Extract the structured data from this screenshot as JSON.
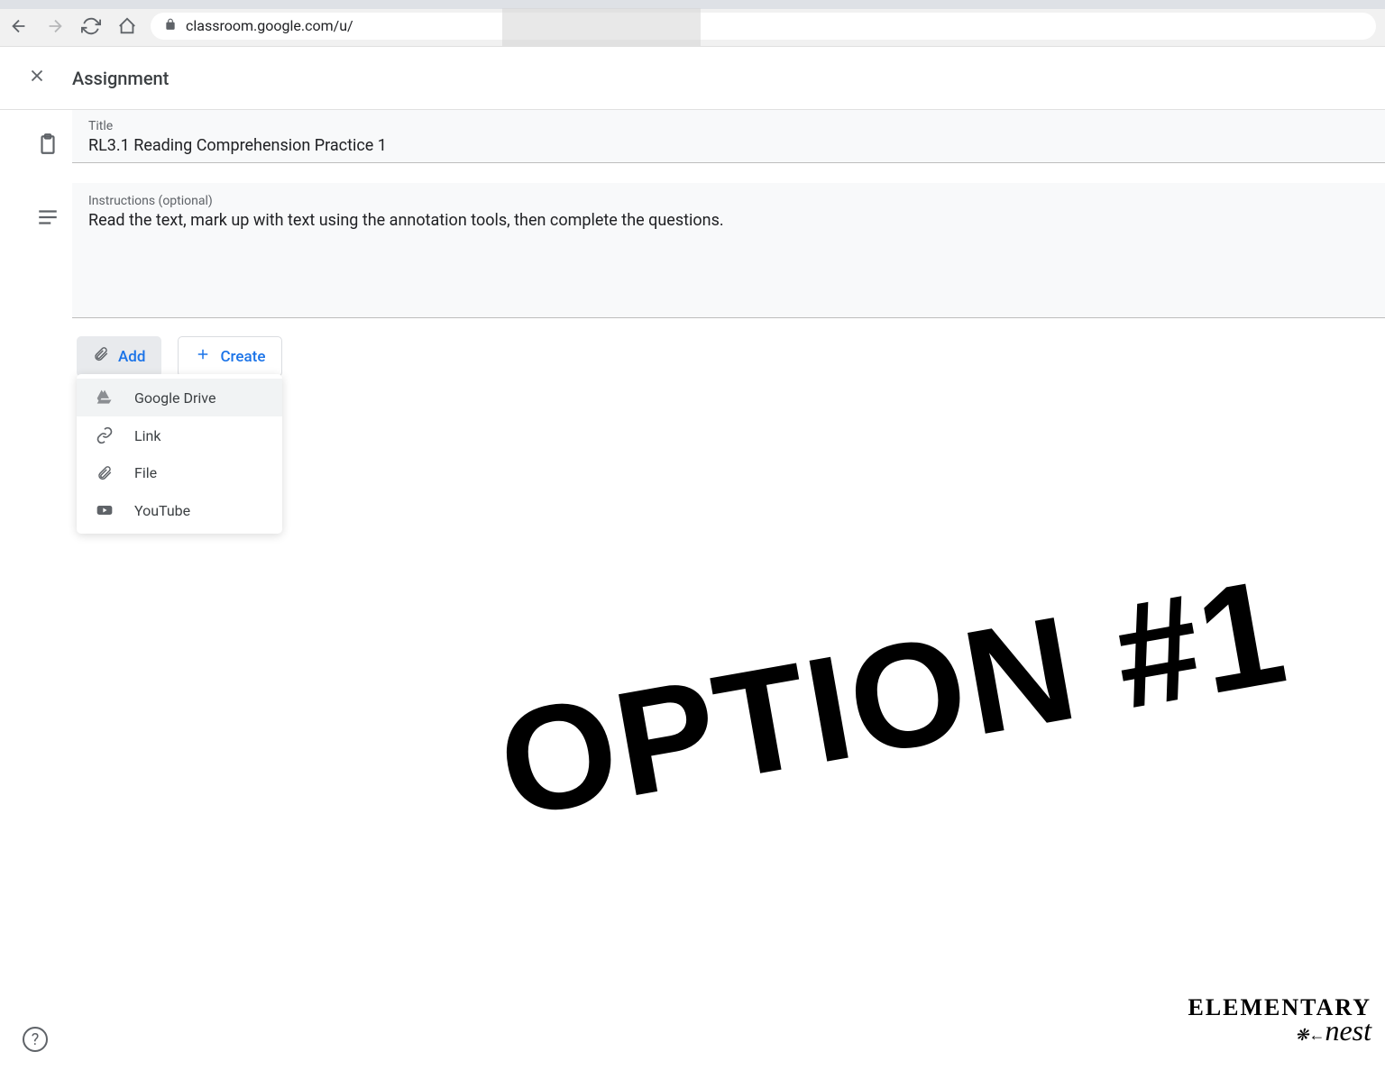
{
  "browser": {
    "url": "classroom.google.com/u/"
  },
  "header": {
    "title": "Assignment"
  },
  "fields": {
    "title_label": "Title",
    "title_value": "RL3.1 Reading Comprehension Practice 1",
    "instructions_label": "Instructions (optional)",
    "instructions_value": "Read the text, mark up with text using the annotation tools, then complete the questions."
  },
  "actions": {
    "add_label": "Add",
    "create_label": "Create"
  },
  "menu": {
    "items": [
      {
        "label": "Google Drive"
      },
      {
        "label": "Link"
      },
      {
        "label": "File"
      },
      {
        "label": "YouTube"
      }
    ]
  },
  "overlay": {
    "text": "OPTION #1"
  },
  "watermark": {
    "line1": "ELEMENTARY",
    "line2": "nest"
  },
  "help": {
    "symbol": "?"
  }
}
